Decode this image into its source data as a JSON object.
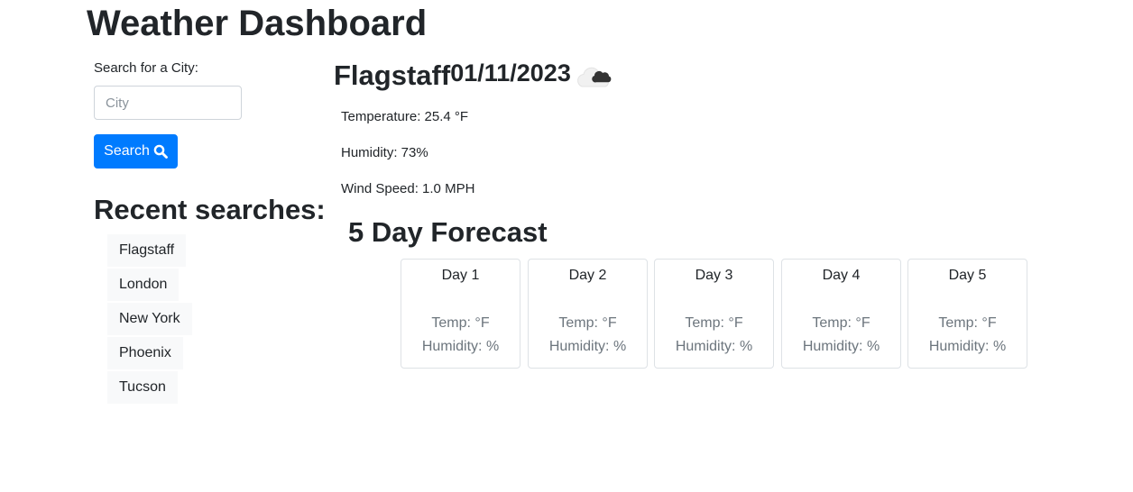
{
  "header": {
    "title": "Weather Dashboard"
  },
  "search": {
    "label": "Search for a City:",
    "placeholder": "City",
    "value": "",
    "button_label": "Search",
    "button_icon": "search-icon"
  },
  "recent": {
    "title": "Recent searches:",
    "items": [
      "Flagstaff",
      "London",
      "New York",
      "Phoenix",
      "Tucson"
    ]
  },
  "current": {
    "city": "Flagstaff",
    "date": "01/11/2023",
    "icon": "cloud-icon",
    "temperature": "Temperature: 25.4 °F",
    "humidity": "Humidity: 73%",
    "wind": "Wind Speed: 1.0 MPH"
  },
  "forecast": {
    "title": "5 Day Forecast",
    "days": [
      {
        "day": "Day 1",
        "temp": "Temp: °F",
        "humidity": "Humidity: %"
      },
      {
        "day": "Day 2",
        "temp": "Temp: °F",
        "humidity": "Humidity: %"
      },
      {
        "day": "Day 3",
        "temp": "Temp: °F",
        "humidity": "Humidity: %"
      },
      {
        "day": "Day 4",
        "temp": "Temp: °F",
        "humidity": "Humidity: %"
      },
      {
        "day": "Day 5",
        "temp": "Temp: °F",
        "humidity": "Humidity: %"
      }
    ]
  },
  "colors": {
    "accent": "#007bff",
    "text": "#212529",
    "muted": "#6c757d",
    "chip_bg": "#f8f9fa",
    "border": "#dee2e6"
  }
}
